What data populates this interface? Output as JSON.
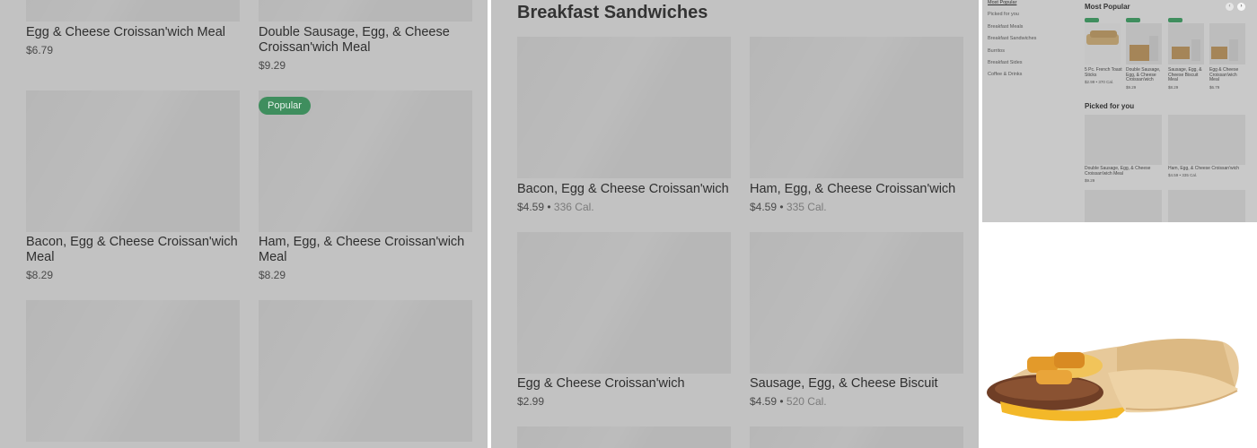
{
  "left": {
    "items": [
      {
        "name": "Egg & Cheese Croissan'wich Meal",
        "price": "$6.79"
      },
      {
        "name": "Double Sausage, Egg, & Cheese Croissan'wich Meal",
        "price": "$9.29"
      },
      {
        "name": "Bacon, Egg & Cheese Croissan'wich Meal",
        "price": "$8.29"
      },
      {
        "name": "Ham, Egg, & Cheese Croissan'wich Meal",
        "price": "$8.29",
        "badge": "Popular"
      }
    ]
  },
  "middle": {
    "section_title": "Breakfast Sandwiches",
    "items": [
      {
        "name": "Bacon, Egg & Cheese Croissan'wich",
        "price": "$4.59",
        "calories": "336 Cal."
      },
      {
        "name": "Ham, Egg, & Cheese Croissan'wich",
        "price": "$4.59",
        "calories": "335 Cal."
      },
      {
        "name": "Egg & Cheese Croissan'wich",
        "price": "$2.99",
        "calories": ""
      },
      {
        "name": "Sausage, Egg, & Cheese Biscuit",
        "price": "$4.59",
        "calories": "520 Cal."
      }
    ],
    "separator": "•"
  },
  "mini": {
    "nav": [
      "Most Popular",
      "Picked for you",
      "Breakfast Meals",
      "Breakfast Sandwiches",
      "Burritos",
      "Breakfast Sides",
      "Coffee & Drinks"
    ],
    "most_popular_title": "Most Popular",
    "popular_items": [
      {
        "name": "5 Pc. French Toast Sticks",
        "price": "$2.99 • 370 Cal."
      },
      {
        "name": "Double Sausage, Egg, & Cheese Croissan'wich",
        "price": "$9.29"
      },
      {
        "name": "Sausage, Egg, & Cheese Biscuit Meal",
        "price": "$8.29"
      },
      {
        "name": "Egg & Cheese Croissan'wich Meal",
        "price": "$6.79"
      }
    ],
    "picked_title": "Picked for you",
    "picked_items": [
      {
        "name": "Double Sausage, Egg, & Cheese Croissan'wich Meal",
        "price": "$9.29"
      },
      {
        "name": "Ham, Egg, & Cheese Croissan'wich",
        "price": "$4.59 • 335 Cal."
      }
    ],
    "prev_icon": "‹",
    "next_icon": "›"
  },
  "colors": {
    "overlay": "#c2c2c2",
    "badge": "#3f8e5e"
  }
}
